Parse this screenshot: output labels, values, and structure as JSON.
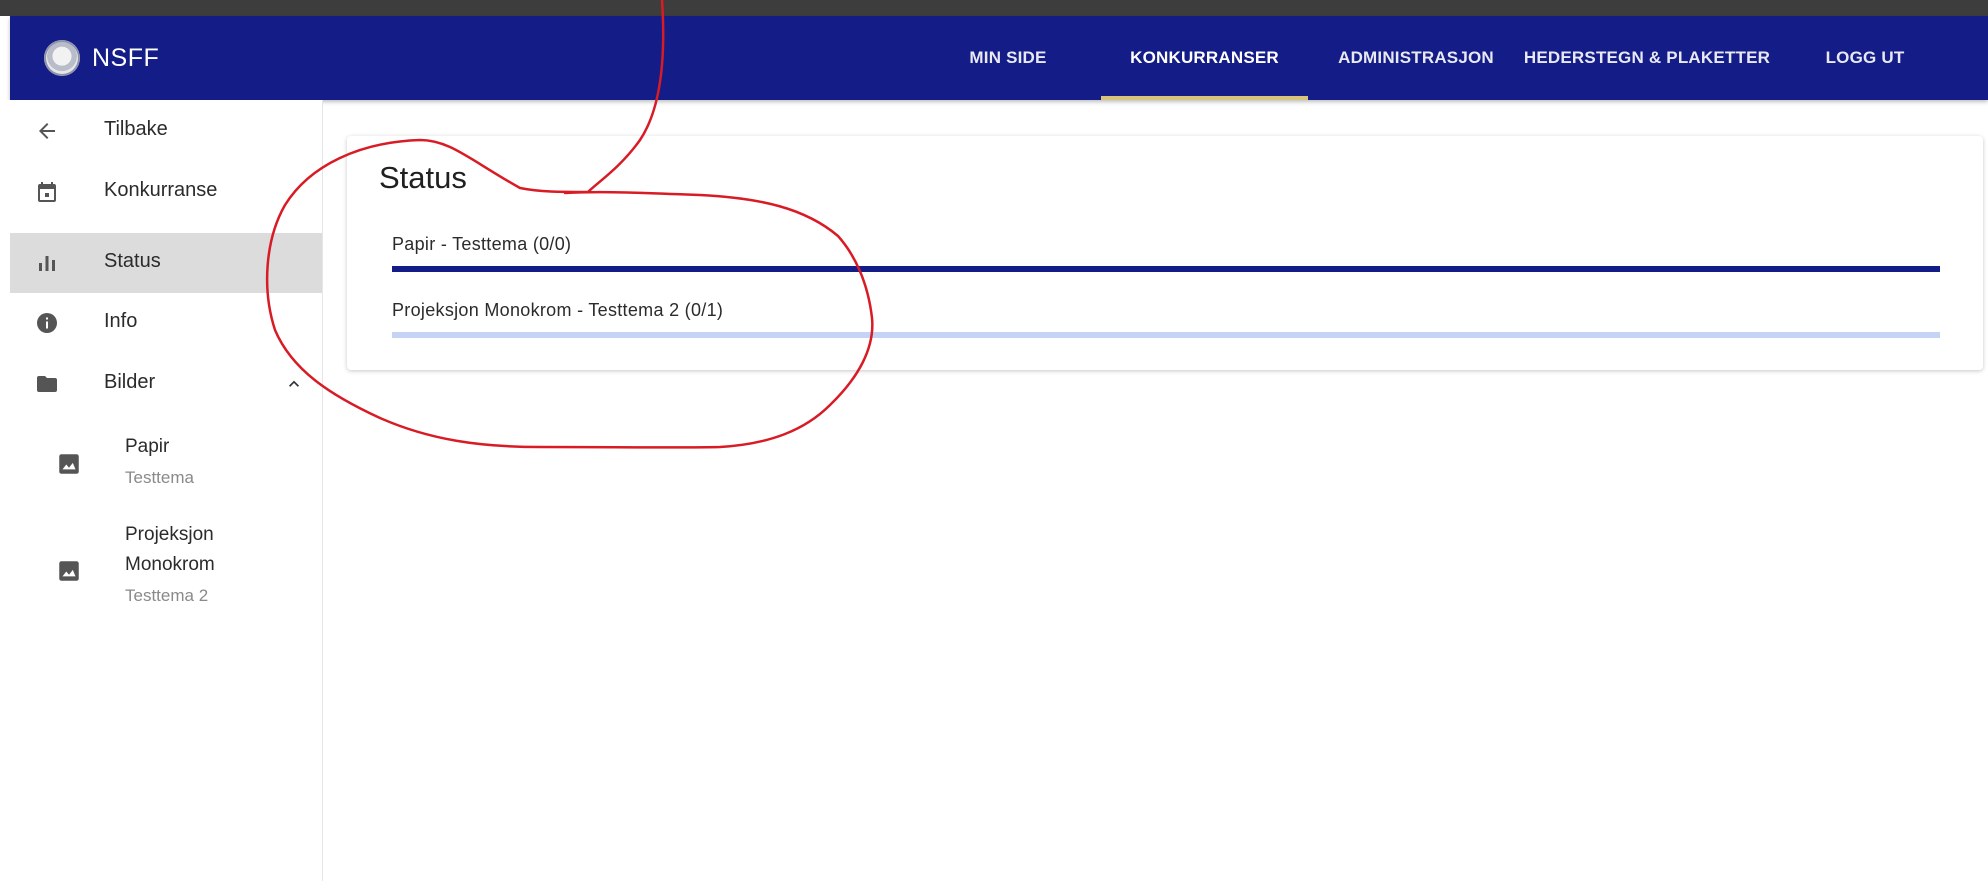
{
  "app": {
    "brand": "NSFF"
  },
  "nav": {
    "items": [
      {
        "label": "MIN SIDE",
        "active": false
      },
      {
        "label": "KONKURRANSER",
        "active": true
      },
      {
        "label": "ADMINISTRASJON",
        "active": false
      },
      {
        "label": "HEDERSTEGN & PLAKETTER",
        "active": false
      },
      {
        "label": "LOGG UT",
        "active": false
      }
    ]
  },
  "sidebar": {
    "items": [
      {
        "label": "Tilbake",
        "icon": "arrow-left-icon"
      },
      {
        "label": "Konkurranse",
        "icon": "calendar-icon"
      },
      {
        "label": "Status",
        "icon": "bar-chart-icon",
        "active": true
      },
      {
        "label": "Info",
        "icon": "info-icon"
      },
      {
        "label": "Bilder",
        "icon": "folder-icon",
        "expanded": true
      }
    ],
    "subitems": [
      {
        "title": "Papir",
        "caption": "Testtema",
        "icon": "image-icon"
      },
      {
        "title_line1": "Projeksjon",
        "title_line2": "Monokrom",
        "caption": "Testtema 2",
        "icon": "image-icon"
      }
    ]
  },
  "main": {
    "title": "Status",
    "rows": [
      {
        "label": "Papir - Testtema (0/0)",
        "progress": 1.0
      },
      {
        "label": "Projeksjon Monokrom - Testtema 2 (0/1)",
        "progress": 0.0
      }
    ]
  },
  "colors": {
    "appbar": "#131c87",
    "active_tab_indicator": "#d8c37a",
    "progress_fill": "#131c87",
    "progress_track": "#c5d4f5",
    "annotation": "#d81b24"
  }
}
